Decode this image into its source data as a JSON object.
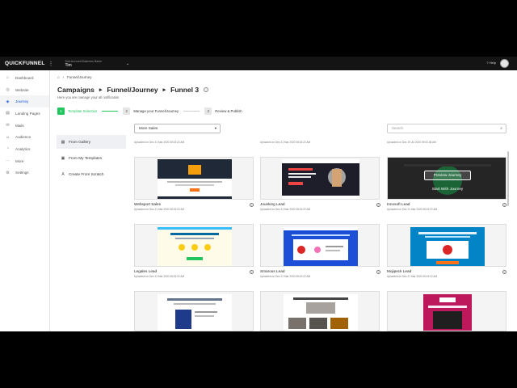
{
  "app": {
    "logo": "QUICKFUNNEL",
    "account_caption": "Sub-Account Business Name",
    "account_name": "Tim",
    "help_label": "Help"
  },
  "sidebar": {
    "items": [
      {
        "label": "Dashboard",
        "icon": "home-icon"
      },
      {
        "label": "Website",
        "icon": "globe-icon"
      },
      {
        "label": "Journey",
        "icon": "journey-icon",
        "active": true
      },
      {
        "label": "Landing Pages",
        "icon": "page-icon"
      },
      {
        "label": "Mails",
        "icon": "mail-icon"
      },
      {
        "label": "Audience",
        "icon": "people-icon"
      },
      {
        "label": "Analytics",
        "icon": "chart-icon"
      },
      {
        "label": "More",
        "icon": "more-icon"
      },
      {
        "label": "Settings",
        "icon": "gear-icon"
      }
    ]
  },
  "breadcrumb": {
    "current": "Funnel/Journey"
  },
  "header": {
    "title_parts": [
      "Campaigns",
      "Funnel/Journey",
      "Funnel 3"
    ],
    "subtitle": "Here you are manage your all notification"
  },
  "steps": [
    {
      "num": "1",
      "label": "Template Selection"
    },
    {
      "num": "2",
      "label": "Manage your Funnel/Journey"
    },
    {
      "num": "3",
      "label": "Review & Publish"
    }
  ],
  "sources": [
    {
      "label": "From Gallery",
      "active": true
    },
    {
      "label": "From My Templates"
    },
    {
      "label": "Create From Scratch"
    }
  ],
  "filter": {
    "selected": "More Sales"
  },
  "search": {
    "placeholder": "Search"
  },
  "top_row_uploaded": [
    "Uploaded on Dec 21 Mar 2020 08:15:22 AM",
    "Uploaded on Dec 21 Mar 2020 08:15:22 AM",
    "Uploaded on Dec 19 Jul 2020 09:51:38 AM"
  ],
  "templates": [
    {
      "name": "Websport Sales",
      "uploaded": "Uploaded on Dec 21 Mar 2020 08:15:22 AM"
    },
    {
      "name": "Jounking Lead",
      "uploaded": "Uploaded on Dec 21 Mar 2020 08:15:22 AM"
    },
    {
      "name": "Innosoft Lead",
      "uploaded": "Uploaded on Dec 21 Mar 2020 08:15:22 AM",
      "hover": true,
      "preview_label": "Preview Journey",
      "start_label": "Start With Journey"
    },
    {
      "name": "Legales Lead",
      "uploaded": "Uploaded on Dec 21 Mar 2020 08:15:22 AM"
    },
    {
      "name": "Smarous Lead",
      "uploaded": "Uploaded on Dec 21 Mar 2020 08:15:22 AM"
    },
    {
      "name": "Mojipeck Lead",
      "uploaded": "Uploaded on Dec 21 Mar 2020 08:15:22 AM"
    }
  ],
  "colors": {
    "accent": "#1a56db",
    "success": "#22c55e",
    "topbar": "#141414"
  }
}
